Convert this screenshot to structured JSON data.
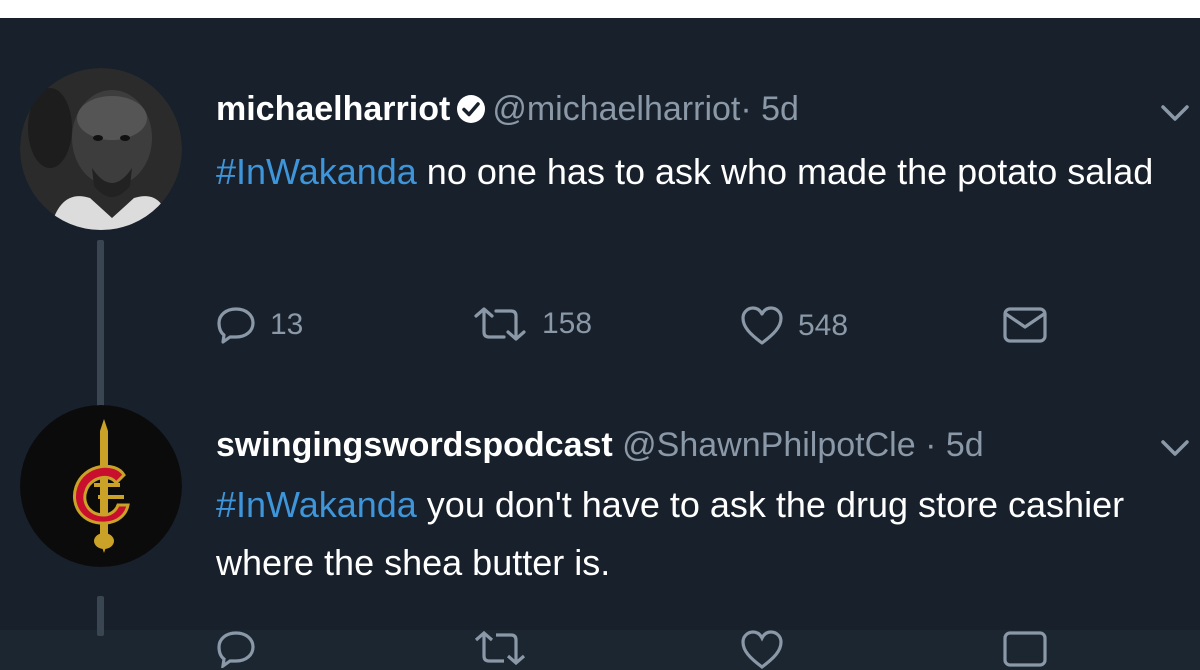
{
  "tweets": [
    {
      "name": "michaelharriot",
      "verified": true,
      "handle": "@michaelharriot",
      "time": "· 5d",
      "hashtag": "#InWakanda",
      "text": " no one has to ask who made the potato salad",
      "actions": {
        "replies": "13",
        "retweets": "158",
        "likes": "548"
      }
    },
    {
      "name": "swingingswordspodcast",
      "verified": false,
      "handle": "@ShawnPhilpotCle",
      "time": "· 5d",
      "hashtag": "#InWakanda",
      "text": " you don't have to ask the drug store cashier where the shea butter is."
    }
  ],
  "colors": {
    "background": "#17202b",
    "hashtag": "#3e95d9",
    "muted": "#8a98a7",
    "accent_red": "#c8102e",
    "accent_gold": "#c9a227"
  }
}
